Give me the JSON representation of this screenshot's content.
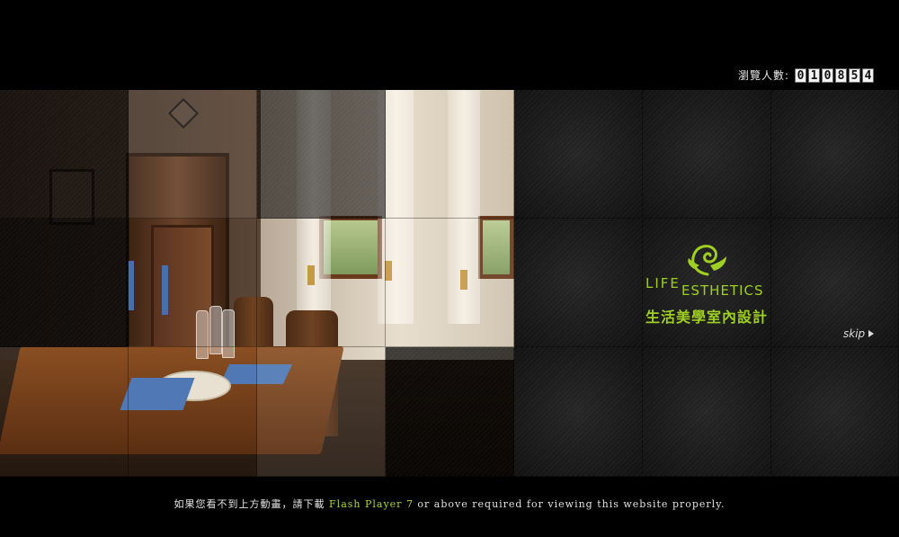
{
  "visitor_counter": {
    "label": "瀏覽人數:",
    "digits": [
      "0",
      "1",
      "0",
      "8",
      "5",
      "4"
    ]
  },
  "logo": {
    "life": "LIFE",
    "esthetics": "ESTHETICS",
    "chinese_name": "生活美學室內設計",
    "accent_color": "#9fcf20",
    "icon": "swirl-leaf-icon"
  },
  "skip": {
    "label": "skip",
    "icon": "triangle-right-icon"
  },
  "footer": {
    "prefix": "如果您看不到上方動畫，請下載 ",
    "link": "Flash Player 7",
    "suffix": " or above required for viewing this website properly.",
    "link_color": "#a9d33b"
  }
}
